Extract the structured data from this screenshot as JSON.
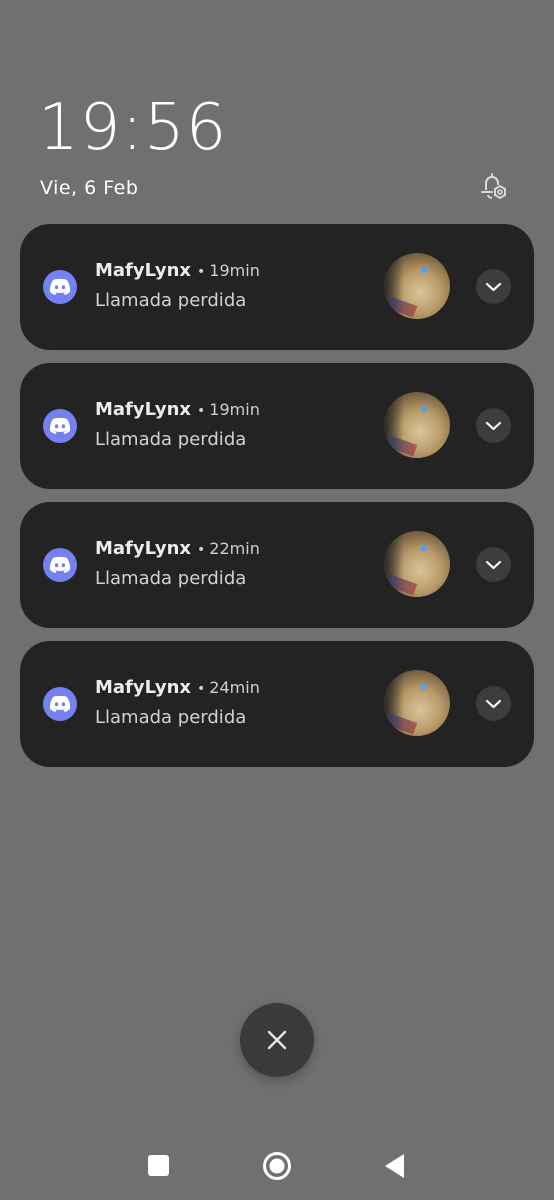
{
  "lockscreen": {
    "time": "19:56",
    "date": "Vie, 6 Feb"
  },
  "notifications": [
    {
      "app_icon": "discord-icon",
      "sender": "MafyLynx",
      "separator": "•",
      "time_ago": "19min",
      "message": "Llamada perdida",
      "expand_icon": "chevron-down-icon"
    },
    {
      "app_icon": "discord-icon",
      "sender": "MafyLynx",
      "separator": "•",
      "time_ago": "19min",
      "message": "Llamada perdida",
      "expand_icon": "chevron-down-icon"
    },
    {
      "app_icon": "discord-icon",
      "sender": "MafyLynx",
      "separator": "•",
      "time_ago": "22min",
      "message": "Llamada perdida",
      "expand_icon": "chevron-down-icon"
    },
    {
      "app_icon": "discord-icon",
      "sender": "MafyLynx",
      "separator": "•",
      "time_ago": "24min",
      "message": "Llamada perdida",
      "expand_icon": "chevron-down-icon"
    }
  ],
  "icons": {
    "notification_settings": "bell-settings-icon",
    "clear_all": "close-icon",
    "nav_recents": "square-icon",
    "nav_home": "circle-icon",
    "nav_back": "triangle-back-icon"
  },
  "colors": {
    "background": "#707070",
    "card": "#232323",
    "discord_accent": "#7581f0"
  }
}
